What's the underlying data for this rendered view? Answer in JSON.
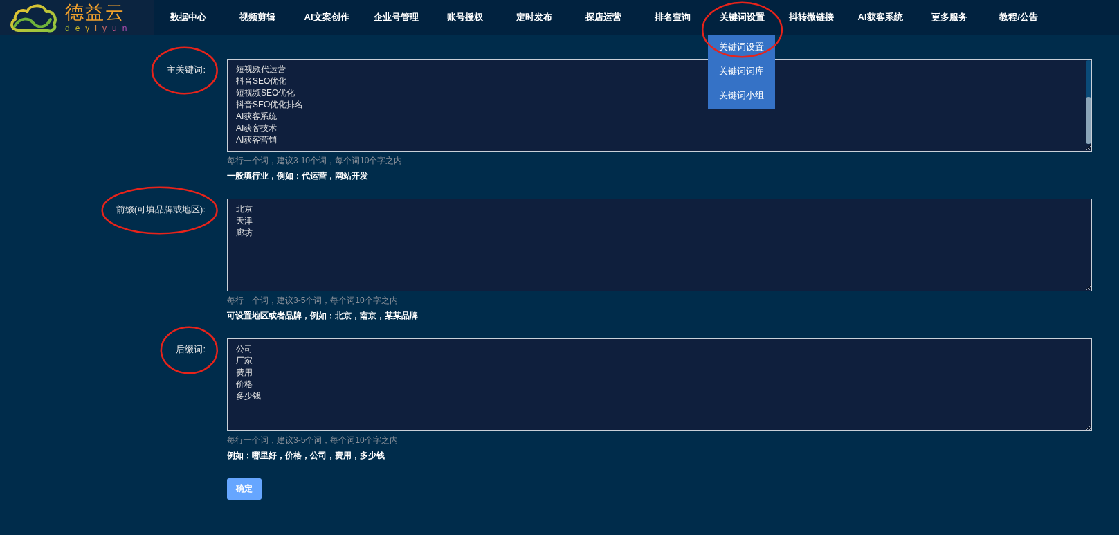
{
  "logo": {
    "title": "德益云",
    "subtitle": "deyiyun"
  },
  "nav": [
    {
      "label": "数据中心",
      "circled": false
    },
    {
      "label": "视频剪辑",
      "circled": false
    },
    {
      "label": "AI文案创作",
      "circled": false
    },
    {
      "label": "企业号管理",
      "circled": false
    },
    {
      "label": "账号授权",
      "circled": false
    },
    {
      "label": "定时发布",
      "circled": false
    },
    {
      "label": "探店运营",
      "circled": false
    },
    {
      "label": "排名查询",
      "circled": false
    },
    {
      "label": "关键词设置",
      "circled": true,
      "expanded": true,
      "children": [
        {
          "label": "关键词设置"
        },
        {
          "label": "关键词词库"
        },
        {
          "label": "关键词小组"
        }
      ]
    },
    {
      "label": "抖转微链接",
      "circled": false
    },
    {
      "label": "AI获客系统",
      "circled": false
    },
    {
      "label": "更多服务",
      "circled": false
    },
    {
      "label": "教程/公告",
      "circled": false
    }
  ],
  "form": {
    "fields": [
      {
        "label": "主关键词:",
        "circled": true,
        "scrolled": true,
        "lines": [
          "短视频代运营",
          "抖音SEO优化",
          "短视频SEO优化",
          "抖音SEO优化排名",
          "AI获客系统",
          "AI获客技术",
          "AI获客营销"
        ],
        "hint": "每行一个词，建议3-10个词，每个词10个字之内",
        "note": "一般填行业，例如：代运营，网站开发"
      },
      {
        "label": "前缀(可填品牌或地区):",
        "circled": true,
        "scrolled": false,
        "lines": [
          "北京",
          "天津",
          "廊坊"
        ],
        "hint": "每行一个词，建议3-5个词，每个词10个字之内",
        "note": "可设置地区或者品牌，例如：北京，南京，某某品牌"
      },
      {
        "label": "后缀词:",
        "circled": true,
        "scrolled": false,
        "lines": [
          "公司",
          "厂家",
          "费用",
          "价格",
          "多少钱"
        ],
        "hint": "每行一个词，建议3-5个词，每个词10个字之内",
        "note": "例如：哪里好，价格，公司，费用，多少钱"
      }
    ],
    "submit": "确定"
  }
}
